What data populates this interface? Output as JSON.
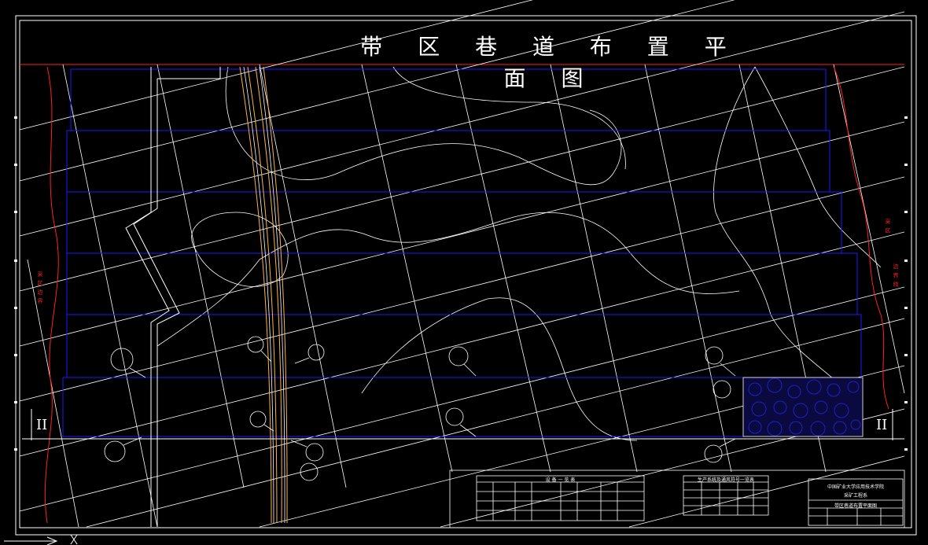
{
  "title": "带 区 巷 道 布 置 平 面 图",
  "section_left": "II",
  "section_right": "II",
  "red_note_left": "采 区 边 界",
  "red_note_right_a": "采 区",
  "red_note_right_b": "边 界 线",
  "equipment_table_title": "设 备 一 览 表",
  "legend_table_title": "生产系统及通风符号一览表",
  "title_block": {
    "school": "中国矿业大学应用技术学院",
    "project": "采矿工程系",
    "drawing_name": "带区巷道布置平面图"
  },
  "colors": {
    "background": "#000000",
    "contour": "#ffffff",
    "roadway": "#1a1aff",
    "shaft": "#ffb347",
    "boundary": "#ff2020",
    "goaf": "#2020c0"
  }
}
